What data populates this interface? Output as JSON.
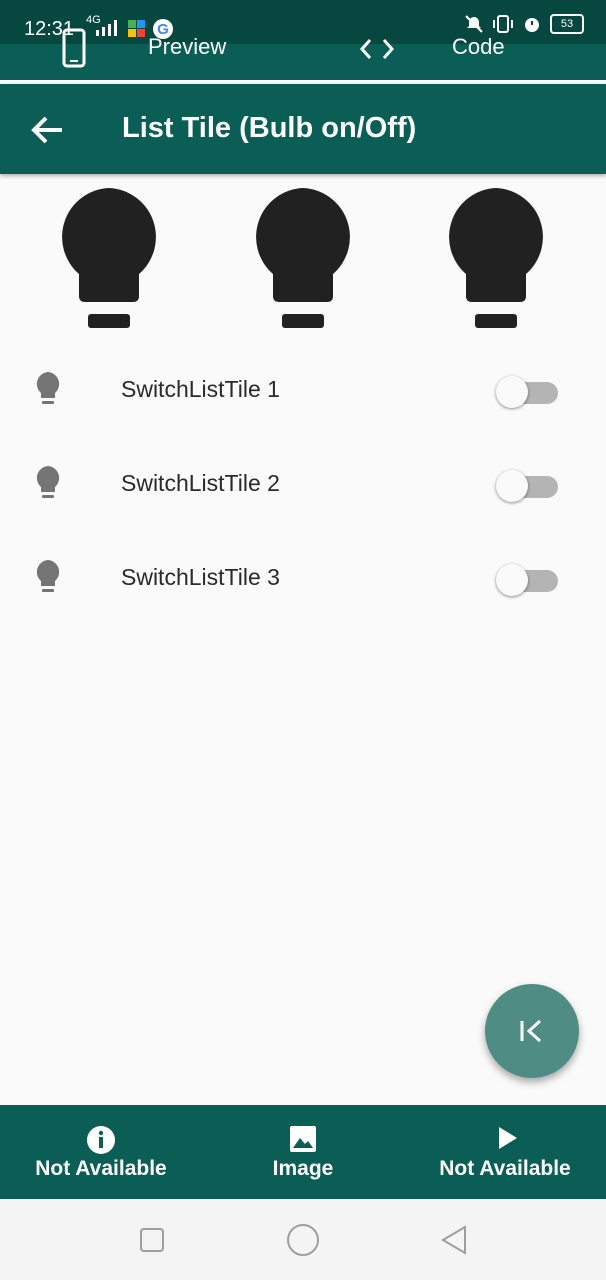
{
  "status_bar": {
    "time": "12:31",
    "network": "4G",
    "battery": "53"
  },
  "tabs": {
    "preview_label": "Preview",
    "code_label": "Code"
  },
  "app_bar": {
    "title": "List Tile (Bulb on/Off)"
  },
  "switch_tiles": [
    {
      "label": "SwitchListTile 1",
      "on": false
    },
    {
      "label": "SwitchListTile 2",
      "on": false
    },
    {
      "label": "SwitchListTile 3",
      "on": false
    }
  ],
  "bottom_nav": [
    {
      "label": "Not Available",
      "icon": "info-icon"
    },
    {
      "label": "Image",
      "icon": "image-icon"
    },
    {
      "label": "Not Available",
      "icon": "play-icon"
    }
  ],
  "colors": {
    "primary": "#0b5e55",
    "fab": "#4f8c84",
    "bulb_off": "#212121",
    "tile_icon": "#757575",
    "switch_track_off": "#b4b4b4"
  }
}
